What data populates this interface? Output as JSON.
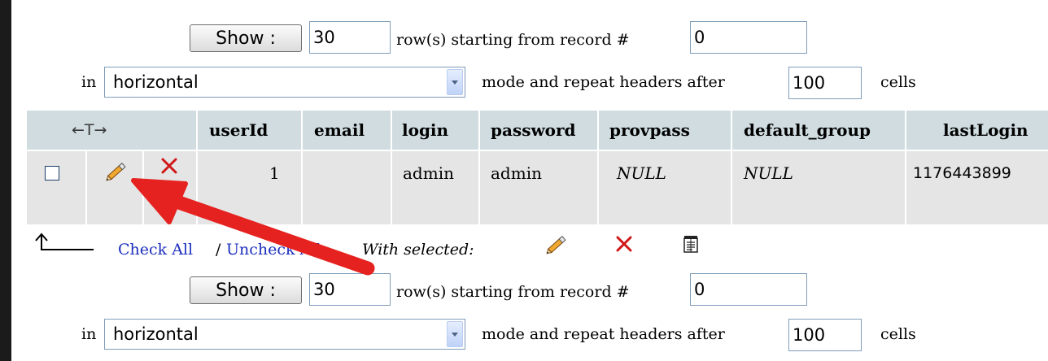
{
  "nav_top": {
    "show_button": "Show :",
    "rows_value": "30",
    "rows_label": "row(s) starting from record #",
    "start_value": "0",
    "in_label": "in",
    "mode_value": "horizontal",
    "mode_label": "mode and repeat headers after",
    "repeat_value": "100",
    "cells_label": "cells"
  },
  "table": {
    "arrows_label": "←T→",
    "headers": [
      "userId",
      "email",
      "login",
      "password",
      "provpass",
      "default_group",
      "lastLogin"
    ],
    "row": {
      "userId": "1",
      "email": "",
      "login": "admin",
      "password": "admin",
      "provpass": "NULL",
      "default_group": "NULL",
      "lastLogin": "1176443899"
    }
  },
  "bulk": {
    "check_all": "Check All",
    "separator": "/",
    "uncheck_all": "Uncheck All",
    "with_selected": "With selected:"
  },
  "nav_bottom": {
    "show_button": "Show :",
    "rows_value": "30",
    "rows_label": "row(s) starting from record #",
    "start_value": "0",
    "in_label": "in",
    "mode_value": "horizontal",
    "mode_label": "mode and repeat headers after",
    "repeat_value": "100",
    "cells_label": "cells"
  },
  "icons": {
    "edit": "pencil-icon",
    "delete": "delete-x-icon",
    "export": "export-icon",
    "annotation": "red-arrow-annotation"
  },
  "colors": {
    "header_bg": "#d0dce0",
    "row_bg": "#e5e5e5",
    "link": "#1c2ebd",
    "delete_red": "#d01818",
    "annotation_red": "#e5221f"
  }
}
